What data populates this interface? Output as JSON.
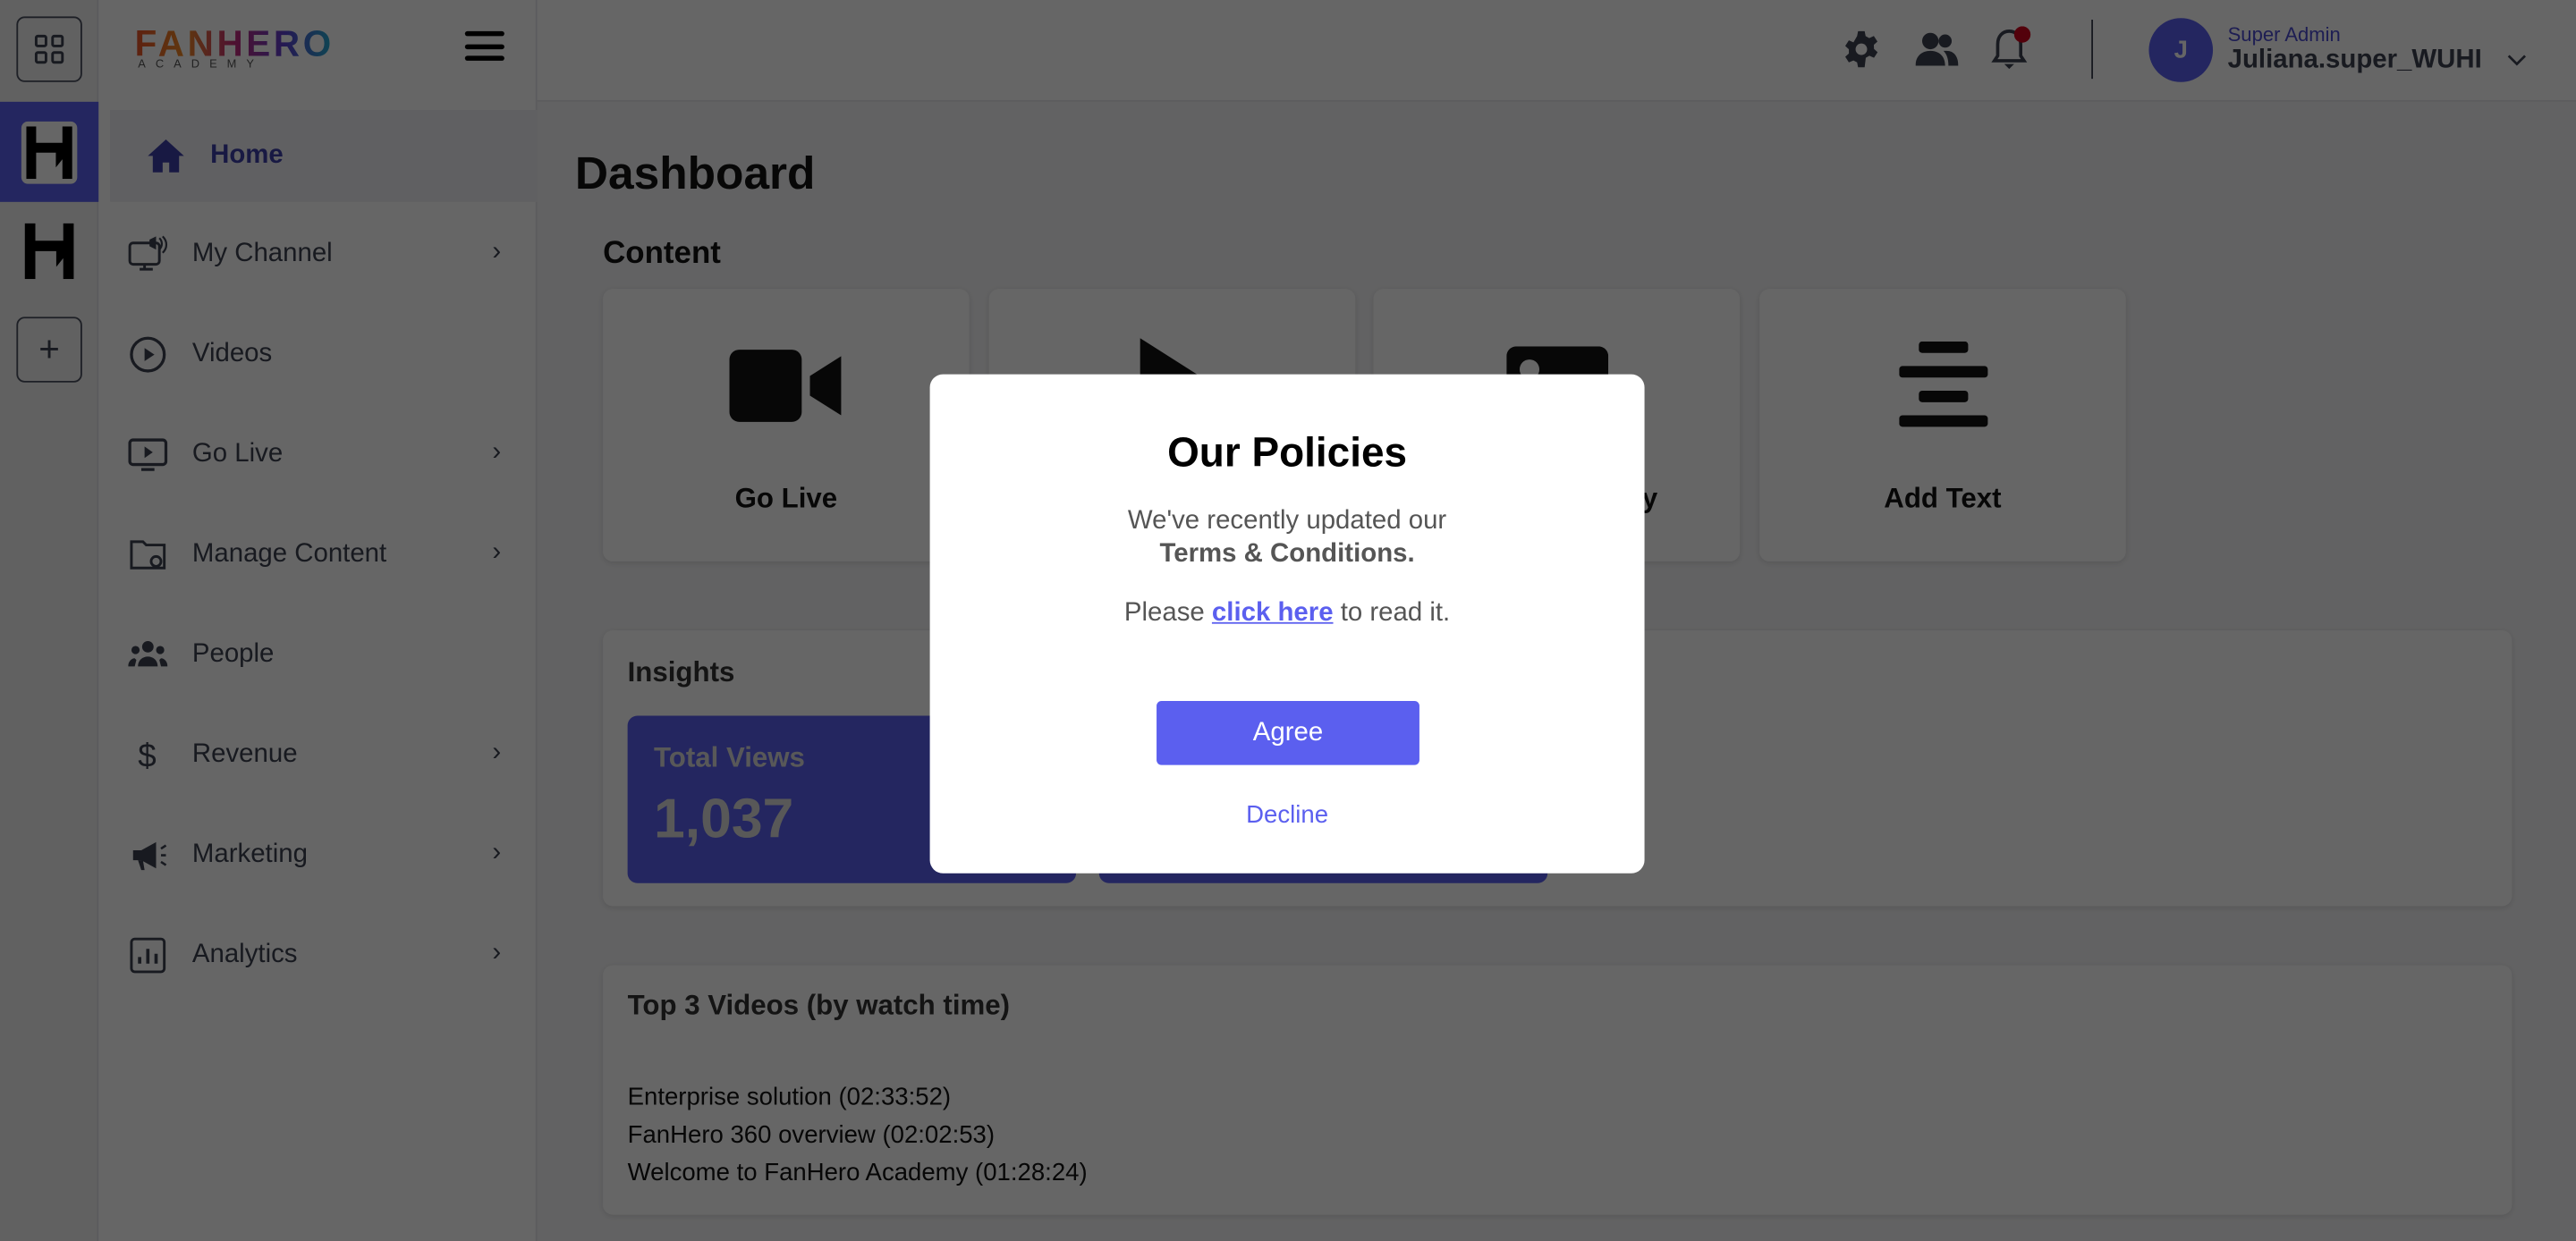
{
  "rail": {
    "add_label": "+"
  },
  "brand": {
    "logo": "FANHERO",
    "sub": "ACADEMY"
  },
  "sidebar": {
    "items": [
      {
        "label": "Home",
        "icon": "home-icon",
        "chevron": false
      },
      {
        "label": "My Channel",
        "icon": "monitor-speaker-icon",
        "chevron": true
      },
      {
        "label": "Videos",
        "icon": "play-circle-icon",
        "chevron": false
      },
      {
        "label": "Go Live",
        "icon": "live-screen-icon",
        "chevron": true
      },
      {
        "label": "Manage Content",
        "icon": "folder-gear-icon",
        "chevron": true
      },
      {
        "label": "People",
        "icon": "people-icon",
        "chevron": false
      },
      {
        "label": "Revenue",
        "icon": "dollar-icon",
        "chevron": true
      },
      {
        "label": "Marketing",
        "icon": "megaphone-icon",
        "chevron": true
      },
      {
        "label": "Analytics",
        "icon": "bar-chart-icon",
        "chevron": true
      }
    ]
  },
  "header": {
    "role": "Super Admin",
    "user": "Juliana.super_WUHI",
    "avatar_initial": "J",
    "notification_dot": "#d0021b"
  },
  "main": {
    "title": "Dashboard",
    "content_heading": "Content",
    "content_cards": [
      {
        "label": "Go Live",
        "icon": "video-camera-icon"
      },
      {
        "label": "",
        "icon": "play-icon"
      },
      {
        "label": "y",
        "icon": "image-icon"
      },
      {
        "label": "Add Text",
        "icon": "text-align-icon"
      }
    ],
    "insights": {
      "heading": "Insights",
      "stats": [
        {
          "label": "Total Views",
          "value": "1,037"
        },
        {
          "label": "",
          "value": ""
        }
      ]
    },
    "top_videos": {
      "heading": "Top 3 Videos (by watch time)",
      "items": [
        "Enterprise solution (02:33:52)",
        "FanHero 360 overview (02:02:53)",
        "Welcome to FanHero Academy (01:28:24)"
      ]
    }
  },
  "modal": {
    "title": "Our Policies",
    "line1": "We've recently updated our",
    "line2": "Terms & Conditions.",
    "please": "Please ",
    "link": "click here",
    "after": " to read it.",
    "agree": "Agree",
    "decline": "Decline"
  },
  "colors": {
    "accent": "#5b5fef",
    "overlay": "rgba(0,0,0,0.6)"
  }
}
